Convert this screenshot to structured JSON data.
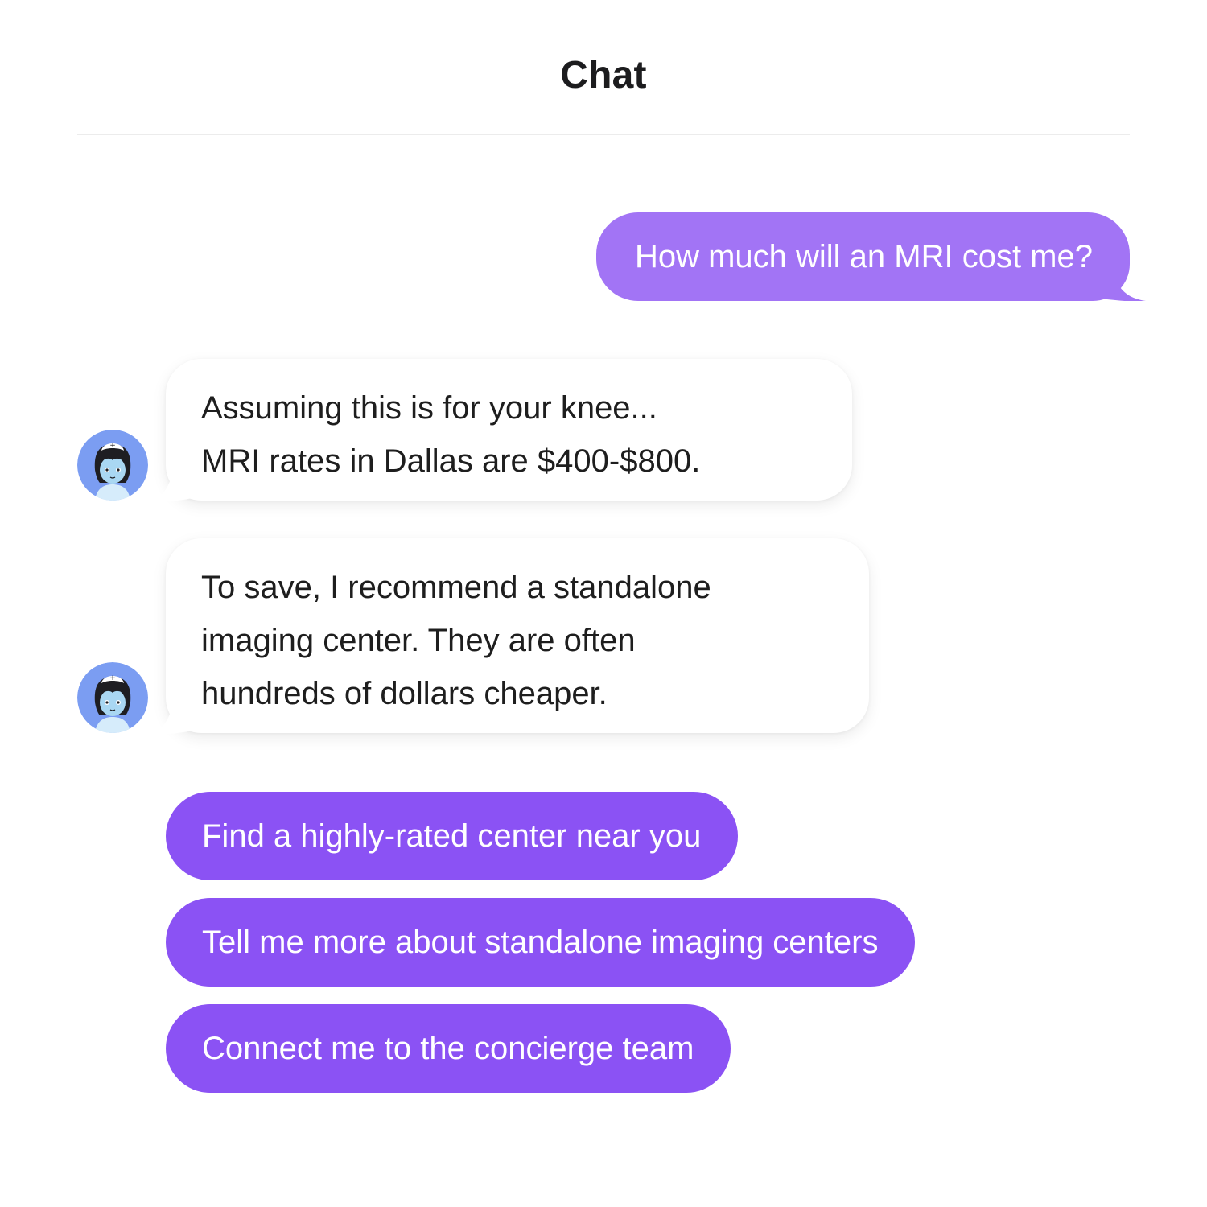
{
  "header": {
    "title": "Chat"
  },
  "messages": {
    "user_question": "How much will an MRI cost me?",
    "bot_reply_1": {
      "line_1": "Assuming this is for your knee...",
      "line_2": "MRI rates in Dallas are $400-$800."
    },
    "bot_reply_2": {
      "line_1": "To save, I recommend a standalone",
      "line_2": "imaging center. They are often",
      "line_3": "hundreds of dollars cheaper."
    }
  },
  "quick_replies": [
    "Find a highly-rated center near you",
    "Tell me more about standalone imaging centers",
    "Connect me to the concierge team"
  ],
  "colors": {
    "user_bubble": "#a274f5",
    "quick_reply": "#8b52f4",
    "avatar_bg": "#7b9df2",
    "bot_bubble": "#ffffff"
  },
  "icons": {
    "avatar": "nurse-avatar-icon"
  }
}
